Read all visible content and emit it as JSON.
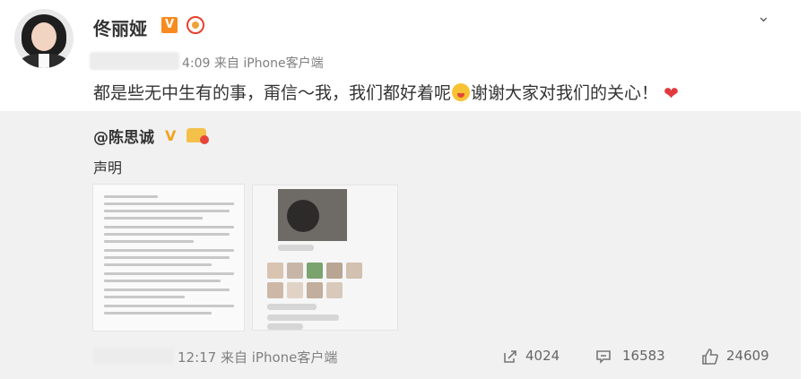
{
  "post": {
    "username": "佟丽娅",
    "verified_badge": "V",
    "time_source": "4:09 来自 iPhone客户端",
    "text_part1": "都是些无中生有的事，甭信～我，我们都好着呢",
    "text_part2": "谢谢大家对我们的关心！",
    "heart": "❤"
  },
  "menu": {
    "chevron": "⌄"
  },
  "repost": {
    "mention": "@陈思诚",
    "verified_badge": "V",
    "text": "声明",
    "time_source": "12:17 来自 iPhone客户端",
    "shares": "4024",
    "comments": "16583",
    "likes": "24609"
  },
  "colors": {
    "accent_orange": "#f78b1f",
    "repost_bg": "#f1f1f1",
    "heart_red": "#e0393e"
  },
  "icons": [
    "chevron-down-icon",
    "share-icon",
    "comment-icon",
    "like-icon"
  ]
}
